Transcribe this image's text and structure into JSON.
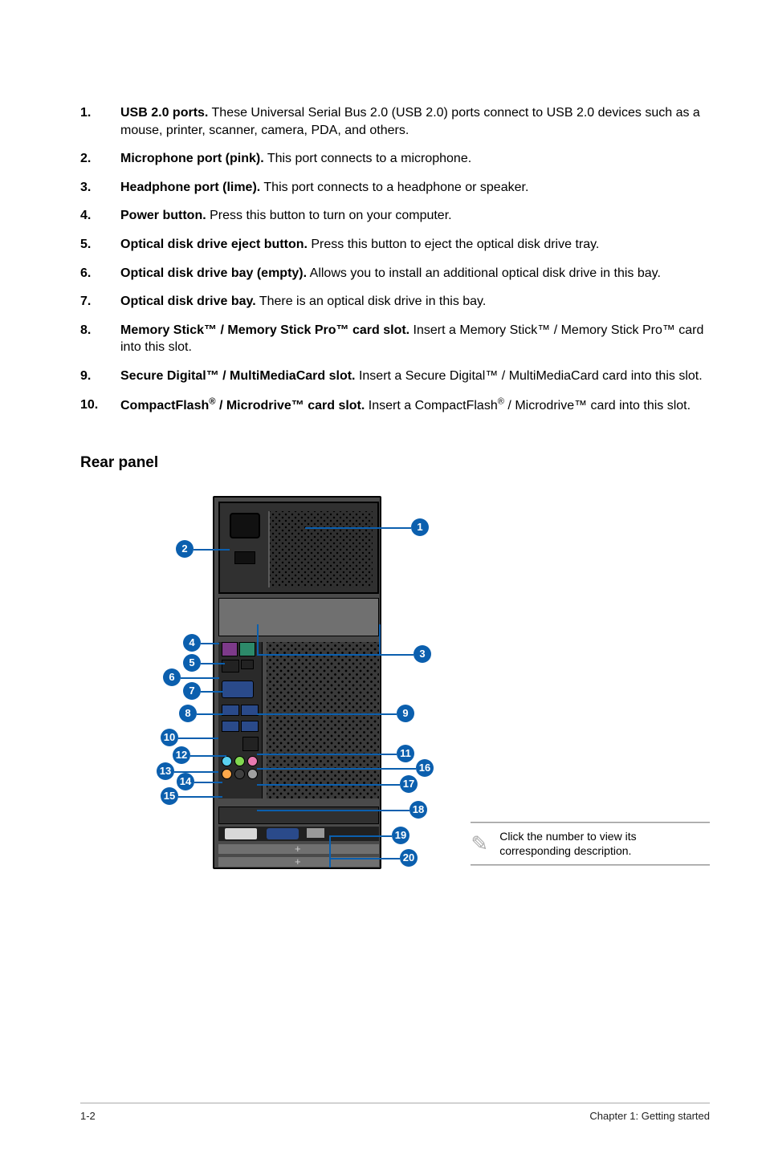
{
  "list": [
    {
      "n": "1.",
      "bold": "USB 2.0 ports.",
      "rest": " These Universal Serial Bus 2.0 (USB 2.0) ports connect to USB 2.0 devices such as a mouse, printer, scanner, camera, PDA, and others."
    },
    {
      "n": "2.",
      "bold": "Microphone port (pink).",
      "rest": " This port connects to a microphone."
    },
    {
      "n": "3.",
      "bold": "Headphone port (lime).",
      "rest": " This port connects to a headphone or speaker."
    },
    {
      "n": "4.",
      "bold": "Power button.",
      "rest": " Press this button to turn on your computer."
    },
    {
      "n": "5.",
      "bold": "Optical disk drive eject button.",
      "rest": " Press this button to eject the optical disk drive tray."
    },
    {
      "n": "6.",
      "bold": "Optical disk drive bay (empty).",
      "rest": " Allows you to install an additional optical disk drive in this bay."
    },
    {
      "n": "7.",
      "bold": "Optical disk drive bay.",
      "rest": " There is an optical disk drive in this bay."
    },
    {
      "n": "8.",
      "bold": "Memory Stick™ / Memory Stick Pro™ card slot.",
      "rest": " Insert a Memory Stick™ / Memory Stick Pro™ card into this slot."
    },
    {
      "n": "9.",
      "bold": "Secure Digital™ / MultiMediaCard slot.",
      "rest": " Insert a Secure Digital™ / MultiMediaCard card into this slot."
    }
  ],
  "item10": {
    "n": "10.",
    "b1": "CompactFlash",
    "sup1": "®",
    "b2": " / Microdrive™ card slot.",
    "r1": " Insert a CompactFlash",
    "sup2": "®",
    "r2": " / Microdrive™ card into this slot."
  },
  "section_heading": "Rear panel",
  "bubbles": {
    "1": "1",
    "2": "2",
    "3": "3",
    "4": "4",
    "5": "5",
    "6": "6",
    "7": "7",
    "8": "8",
    "9": "9",
    "10": "10",
    "11": "11",
    "12": "12",
    "13": "13",
    "14": "14",
    "15": "15",
    "16": "16",
    "17": "17",
    "18": "18",
    "19": "19",
    "20": "20"
  },
  "note_text": "Click the number to view its corresponding description.",
  "footer_left": "1-2",
  "footer_right": "Chapter 1: Getting started"
}
